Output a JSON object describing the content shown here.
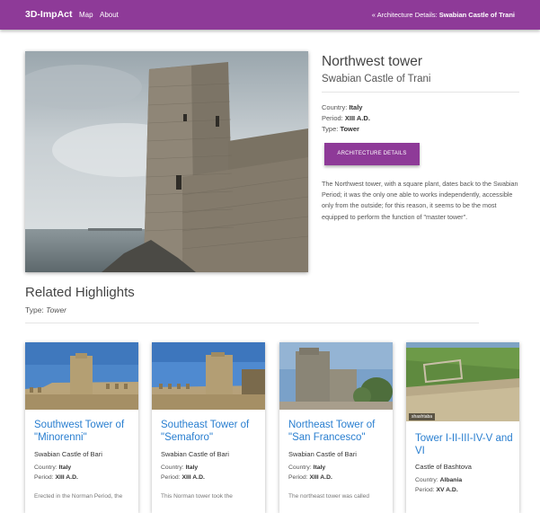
{
  "nav": {
    "brand": "3D-ImpAct",
    "links": [
      "Map",
      "About"
    ],
    "breadcrumb_prefix": "« Architecture Details:",
    "breadcrumb_current": "Swabian Castle of Trani"
  },
  "detail": {
    "title": "Northwest tower",
    "subtitle": "Swabian Castle of Trani",
    "country_label": "Country:",
    "country": "Italy",
    "period_label": "Period:",
    "period": "XIII A.D.",
    "type_label": "Type:",
    "type": "Tower",
    "button": "ARCHITECTURE DETAILS",
    "description": "The Northwest tower, with a square plant, dates back to the Swabian Period; it was the only one able to works independently, accessible only from the outside; for this reason, it seems to be the most equipped to perform the function of \"master tower\"."
  },
  "related": {
    "title": "Related Highlights",
    "type_label": "Type:",
    "type_value": "Tower",
    "cards": [
      {
        "title": "Southwest Tower of \"Minorenni\"",
        "castle": "Swabian Castle of Bari",
        "country_label": "Country:",
        "country": "Italy",
        "period_label": "Period:",
        "period": "XIII A.D.",
        "snippet": "Erected in the Norman Period, the"
      },
      {
        "title": "Southeast Tower of \"Semaforo\"",
        "castle": "Swabian Castle of Bari",
        "country_label": "Country:",
        "country": "Italy",
        "period_label": "Period:",
        "period": "XIII A.D.",
        "snippet": "This Norman tower took the"
      },
      {
        "title": "Northeast Tower of \"San Francesco\"",
        "castle": "Swabian Castle of Bari",
        "country_label": "Country:",
        "country": "Italy",
        "period_label": "Period:",
        "period": "XIII A.D.",
        "snippet": "The northeast tower was called"
      },
      {
        "title": "Tower I-II-III-IV-V and VI",
        "castle": "Castle of Bashtova",
        "country_label": "Country:",
        "country": "Albania",
        "period_label": "Period:",
        "period": "XV A.D.",
        "snippet": "",
        "watermark": "shashtaba"
      }
    ]
  },
  "colors": {
    "accent": "#8e3a98",
    "link": "#2a7fd0"
  }
}
